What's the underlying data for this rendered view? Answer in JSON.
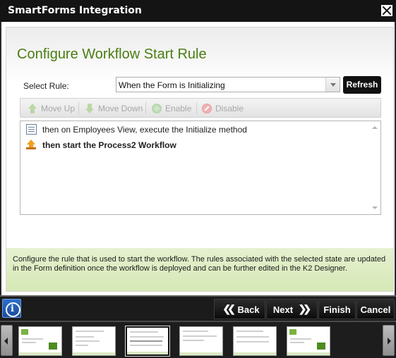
{
  "window": {
    "title": "SmartForms Integration",
    "close_icon": "close-icon"
  },
  "page": {
    "heading": "Configure Workflow Start Rule"
  },
  "rule_selector": {
    "label": "Select Rule:",
    "selected_value": "When the Form is Initializing",
    "refresh_label": "Refresh"
  },
  "toolbar": {
    "move_up_label": "Move Up",
    "move_down_label": "Move Down",
    "enable_label": "Enable",
    "disable_label": "Disable"
  },
  "rule_items": [
    {
      "icon": "form-view-icon",
      "text": "then on Employees View, execute the Initialize method",
      "bold": false
    },
    {
      "icon": "start-workflow-icon",
      "text": "then start the Process2 Workflow",
      "bold": true
    }
  ],
  "info_text": "Configure the rule that is used to start the workflow. The rules associated with the selected state are updated in the Form definition once the workflow is deployed and can be further edited in the K2 Designer.",
  "nav": {
    "back_label": "Back",
    "next_label": "Next",
    "finish_label": "Finish",
    "cancel_label": "Cancel",
    "info_icon": "info-icon"
  },
  "thumbnails": {
    "count": 7,
    "active_index": 2
  },
  "colors": {
    "heading": "#4a7d12",
    "info_background": "#e2efcb",
    "title_bar": "#141414"
  }
}
